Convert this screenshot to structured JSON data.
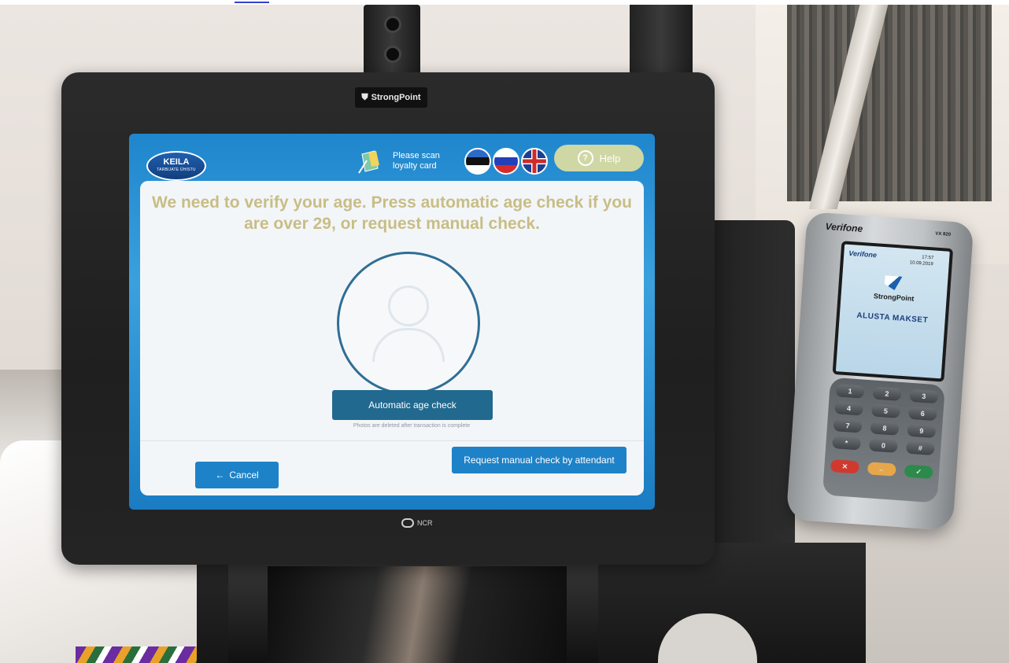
{
  "kiosk": {
    "brand_plate": "StrongPoint",
    "monitor_brand": "NCR"
  },
  "screen": {
    "store_logo": {
      "name": "KEILA",
      "tagline": "TARBIJATE ÜHISTU"
    },
    "loyalty_prompt": "Please scan loyalty card",
    "languages": [
      "Estonian",
      "Russian",
      "English"
    ],
    "help_label": "Help",
    "heading": "We need to verify your age. Press automatic age check if you are over 29, or request manual check.",
    "auto_check_label": "Automatic age check",
    "photo_note": "Photos are deleted after transaction is complete",
    "cancel_label": "Cancel",
    "manual_check_label": "Request manual check by attendant"
  },
  "terminal": {
    "brand": "Verifone",
    "model": "VX 820",
    "screen_brand": "Verifone",
    "screen_time": "17:57",
    "screen_date": "10.09.2019",
    "screen_logo": "StrongPoint",
    "screen_message": "ALUSTA MAKSET",
    "keys": [
      "1",
      "2",
      "3",
      "4",
      "5",
      "6",
      "7",
      "8",
      "9",
      "*",
      "0",
      "#",
      "✕",
      "←",
      "✓"
    ]
  },
  "colors": {
    "screen_blue": "#1f86cd",
    "heading_gold": "#c8bd86",
    "primary_button": "#21698f",
    "secondary_button": "#1e82c8",
    "help_button": "#cfd7a4"
  }
}
